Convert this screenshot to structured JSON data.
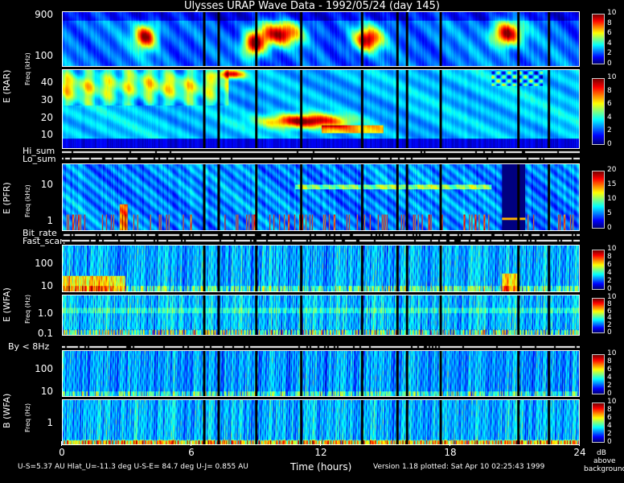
{
  "title": "Ulysses URAP Wave Data - 1992/05/24  (day 145)",
  "chart_data": [
    {
      "type": "heatmap",
      "instrument": "E (RAR)",
      "ylabel": "E (RAR)",
      "yticks": [
        "900",
        "100"
      ],
      "colorbar": {
        "ticks": [
          "10",
          "8",
          "6",
          "4",
          "2",
          "0"
        ],
        "range": [
          0,
          10
        ]
      }
    },
    {
      "type": "heatmap",
      "instrument": "E (RAR)",
      "ylabel": "Freq (kHz)",
      "yticks": [
        "40",
        "30",
        "20",
        "10"
      ],
      "colorbar": {
        "ticks": [
          "10",
          "8",
          "6",
          "4",
          "2",
          "0"
        ],
        "range": [
          0,
          10
        ]
      }
    },
    {
      "type": "heatmap",
      "instrument": "E (PFR)",
      "ylabel": "E (PFR)",
      "sublabel": "Freq (kHz)",
      "yticks": [
        "10",
        "1"
      ],
      "colorbar": {
        "ticks": [
          "20",
          "15",
          "10",
          "5",
          "0"
        ],
        "range": [
          0,
          20
        ]
      }
    },
    {
      "type": "heatmap",
      "instrument": "E (WFA)",
      "ylabel": "E (WFA)",
      "yticks": [
        "100",
        "10"
      ],
      "colorbar": {
        "ticks": [
          "10",
          "8",
          "6",
          "4",
          "2",
          "0"
        ],
        "range": [
          0,
          10
        ]
      }
    },
    {
      "type": "heatmap",
      "instrument": "E (WFA)",
      "ylabel": "Freq (Hz)",
      "yticks": [
        "1.0",
        "0.1"
      ],
      "colorbar": {
        "ticks": [
          "10",
          "8",
          "6",
          "4",
          "2",
          "0"
        ],
        "range": [
          0,
          10
        ]
      }
    },
    {
      "type": "heatmap",
      "instrument": "B (WFA)",
      "ylabel": "B (WFA)",
      "yticks": [
        "100",
        "10"
      ],
      "colorbar": {
        "ticks": [
          "10",
          "8",
          "6",
          "4",
          "2",
          "0"
        ],
        "range": [
          0,
          10
        ]
      }
    },
    {
      "type": "heatmap",
      "instrument": "B (WFA)",
      "ylabel": "Freq (Hz)",
      "yticks": [
        "1"
      ],
      "colorbar": {
        "ticks": [
          "10",
          "8",
          "6",
          "4",
          "2",
          "0"
        ],
        "range": [
          0,
          10
        ]
      }
    }
  ],
  "x_axis": {
    "label": "Time (hours)",
    "ticks": [
      "0",
      "6",
      "12",
      "18",
      "24"
    ],
    "range": [
      0,
      24
    ]
  },
  "strip_labels": {
    "hi_sum": "Hi_sum",
    "lo_sum": "Lo_sum",
    "bit_rate": "Bit_rate",
    "fast_scan": "Fast_scan",
    "by": "By < 8Hz"
  },
  "panel_labels": {
    "rar": "E (RAR)",
    "rar_freq": "Freq (kHz)",
    "pfr": "E (PFR)",
    "pfr_freq": "Freq (kHz)",
    "efa": "E (WFA)",
    "efa_freq": "Freq (Hz)",
    "bfa": "B (WFA)",
    "bfa_freq": "Freq (Hz)"
  },
  "colorbar_unit": [
    "dB",
    "above",
    "background"
  ],
  "footer": {
    "left": "U-S=5.37 AU  Hlat_U=-11.3 deg  U-S-E= 84.7 deg  U-J= 0.855 AU",
    "right": "Version 1.18 plotted: Sat Apr 10 02:25:43 1999"
  },
  "colors": {
    "background": "#000000",
    "frame": "#ffffff"
  }
}
